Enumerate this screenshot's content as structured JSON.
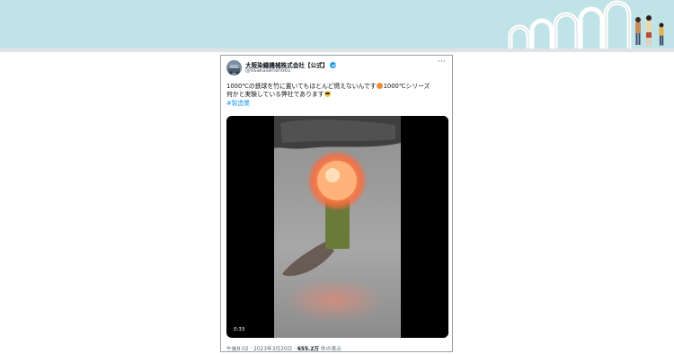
{
  "account": {
    "name": "大阪染織機械株式会社【公式】",
    "handle": "@osakasenshoku"
  },
  "tweet": {
    "line1": "1000℃の鉄球を竹に置いてもほとんど燃えないんです",
    "line1_tail": "1000℃シリーズ",
    "line2": "何かと実験している弊社であります",
    "hashtag": "#製造業"
  },
  "video": {
    "timecode": "0:33"
  },
  "meta": {
    "time": "午後8:02 · 2023年3月20日 · ",
    "views": "655.2万",
    "views_suffix": " 件の表示"
  },
  "menu": {
    "more": "···"
  }
}
